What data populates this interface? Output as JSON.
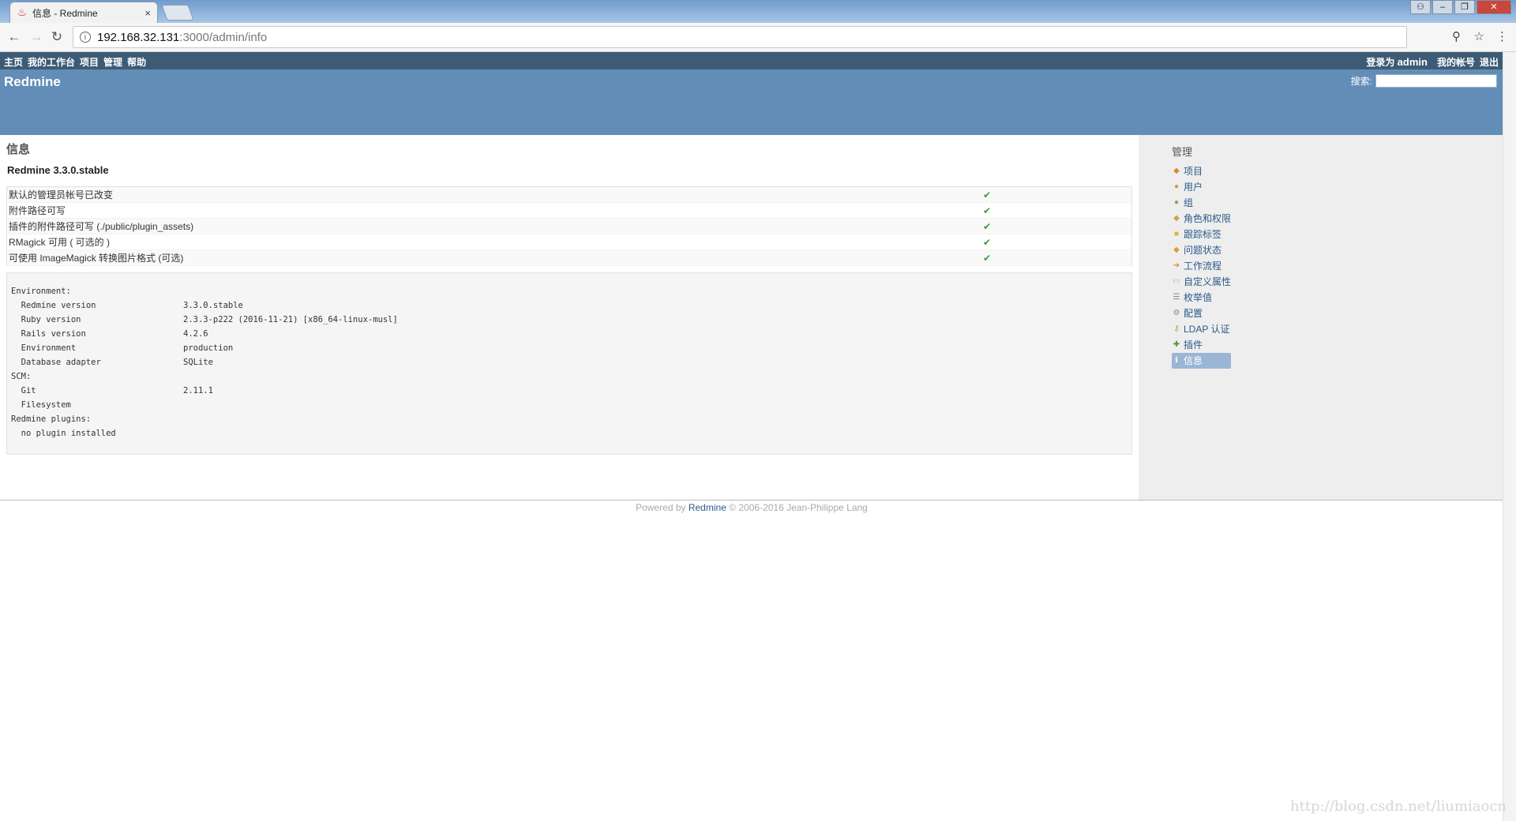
{
  "browser": {
    "tab_title": "信息 - Redmine",
    "tab_close": "×",
    "url_host": "192.168.32.131",
    "url_path": ":3000/admin/info"
  },
  "top_menu": {
    "left": [
      "主页",
      "我的工作台",
      "项目",
      "管理",
      "帮助"
    ],
    "logged_as_prefix": "登录为",
    "logged_as_user": "admin",
    "my_account": "我的帐号",
    "logout": "退出"
  },
  "header": {
    "title": "Redmine",
    "search_label": "搜索:",
    "search_value": ""
  },
  "content": {
    "page_title": "信息",
    "version": "Redmine 3.3.0.stable",
    "checks": [
      {
        "label": "默认的管理员帐号已改变",
        "ok": "✔"
      },
      {
        "label": "附件路径可写",
        "ok": "✔"
      },
      {
        "label": "插件的附件路径可写 (./public/plugin_assets)",
        "ok": "✔"
      },
      {
        "label": "RMagick 可用 ( 可选的 )",
        "ok": "✔"
      },
      {
        "label": "可使用 ImageMagick 转换图片格式 (可选)",
        "ok": "✔"
      }
    ],
    "environment": [
      {
        "key": "Environment:",
        "value": ""
      },
      {
        "key": "  Redmine version",
        "value": "3.3.0.stable"
      },
      {
        "key": "  Ruby version",
        "value": "2.3.3-p222 (2016-11-21) [x86_64-linux-musl]"
      },
      {
        "key": "  Rails version",
        "value": "4.2.6"
      },
      {
        "key": "  Environment",
        "value": "production"
      },
      {
        "key": "  Database adapter",
        "value": "SQLite"
      },
      {
        "key": "SCM:",
        "value": ""
      },
      {
        "key": "  Git",
        "value": "2.11.1"
      },
      {
        "key": "  Filesystem",
        "value": ""
      },
      {
        "key": "Redmine plugins:",
        "value": ""
      },
      {
        "key": "  no plugin installed",
        "value": ""
      }
    ]
  },
  "sidebar": {
    "title": "管理",
    "items": [
      {
        "label": "项目",
        "icon": "projects-icon",
        "color": "#d58a2a"
      },
      {
        "label": "用户",
        "icon": "user-icon",
        "color": "#c99a3a"
      },
      {
        "label": "组",
        "icon": "group-icon",
        "color": "#b08a5a"
      },
      {
        "label": "角色和权限",
        "icon": "roles-icon",
        "color": "#c9a04a"
      },
      {
        "label": "跟踪标签",
        "icon": "tracker-icon",
        "color": "#e0b040"
      },
      {
        "label": "问题状态",
        "icon": "issue-status-icon",
        "color": "#d8a030"
      },
      {
        "label": "工作流程",
        "icon": "workflow-icon",
        "color": "#e08a20"
      },
      {
        "label": "自定义属性",
        "icon": "custom-fields-icon",
        "color": "#bbbbbb"
      },
      {
        "label": "枚举值",
        "icon": "list-icon",
        "color": "#7a8aa0"
      },
      {
        "label": "配置",
        "icon": "settings-icon",
        "color": "#888888"
      },
      {
        "label": "LDAP 认证",
        "icon": "ldap-icon",
        "color": "#c0a050"
      },
      {
        "label": "插件",
        "icon": "plugin-icon",
        "color": "#4a9a3a"
      },
      {
        "label": "信息",
        "icon": "info-icon",
        "color": "#ffffff",
        "selected": true
      }
    ]
  },
  "footer": {
    "prefix": "Powered by ",
    "link": "Redmine",
    "suffix": " © 2006-2016 Jean-Philippe Lang"
  },
  "watermark": "http://blog.csdn.net/liumiaocn"
}
